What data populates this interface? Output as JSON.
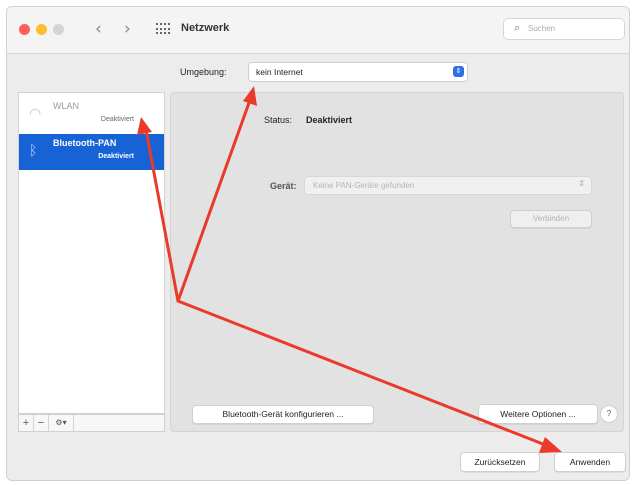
{
  "window": {
    "title": "Netzwerk",
    "search_placeholder": "Suchen",
    "nav_back": "‹",
    "nav_forward": "›"
  },
  "location": {
    "label": "Umgebung:",
    "value": "kein Internet"
  },
  "services": [
    {
      "name": "WLAN",
      "status": "Deaktiviert",
      "icon": "wifi-icon",
      "selected": false
    },
    {
      "name": "Bluetooth-PAN",
      "status": "Deaktiviert",
      "icon": "bluetooth-icon",
      "selected": true
    }
  ],
  "sidebar_tools": {
    "add": "+",
    "remove": "−",
    "action": "⚙▾"
  },
  "detail": {
    "status_label": "Status:",
    "status_value": "Deaktiviert",
    "device_label": "Gerät:",
    "device_value": "Keine PAN-Geräte gefunden",
    "connect_button": "Verbinden",
    "configure_button": "Bluetooth-Gerät konfigurieren ...",
    "advanced_button": "Weitere Optionen ...",
    "help_button": "?"
  },
  "footer": {
    "reset_button": "Zurücksetzen",
    "apply_button": "Anwenden"
  },
  "colors": {
    "selection_blue": "#1763d6",
    "annotation_red": "#ea3a2b",
    "close": "#ff5f57",
    "minimize": "#febc2e"
  }
}
